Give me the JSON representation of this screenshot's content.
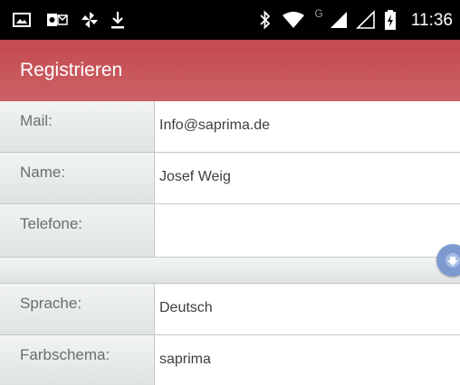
{
  "status_bar": {
    "time": "11:36",
    "left_icons": [
      "image-icon",
      "outlook-icon",
      "pinwheel-icon",
      "download-icon"
    ],
    "right_icons": [
      "bluetooth-icon",
      "wifi-icon",
      "network-g-icon",
      "signal-full-icon",
      "signal-empty-icon",
      "battery-charging-icon"
    ],
    "network_label": "G"
  },
  "app_bar": {
    "title": "Registrieren"
  },
  "form": {
    "rows": [
      {
        "label": "Mail:",
        "value": "Info@saprima.de"
      },
      {
        "label": "Name:",
        "value": "Josef Weig"
      },
      {
        "label": "Telefone:",
        "value": ""
      },
      {
        "label": "Sprache:",
        "value": "Deutsch"
      },
      {
        "label": "Farbschema:",
        "value": "saprima"
      }
    ]
  },
  "scroll_button": {
    "icon": "arrow-down-icon"
  }
}
